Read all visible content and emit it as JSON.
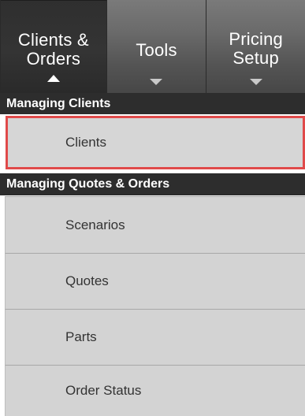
{
  "tabs": [
    {
      "label": "Clients &\nOrders",
      "active": true,
      "indicator": "triangle-up-icon"
    },
    {
      "label": "Tools",
      "active": false,
      "indicator": "triangle-down-icon"
    },
    {
      "label": "Pricing\nSetup",
      "active": false,
      "indicator": "triangle-down-icon"
    }
  ],
  "sections": [
    {
      "title": "Managing Clients",
      "items": [
        {
          "label": "Clients",
          "selected": true
        }
      ]
    },
    {
      "title": "Managing Quotes & Orders",
      "items": [
        {
          "label": "Scenarios"
        },
        {
          "label": "Quotes"
        },
        {
          "label": "Parts"
        },
        {
          "label": "Order Status"
        }
      ]
    }
  ],
  "colors": {
    "selected_border": "#e04a4a",
    "header_bg": "#2d2d2d",
    "item_bg": "#d3d3d3"
  }
}
